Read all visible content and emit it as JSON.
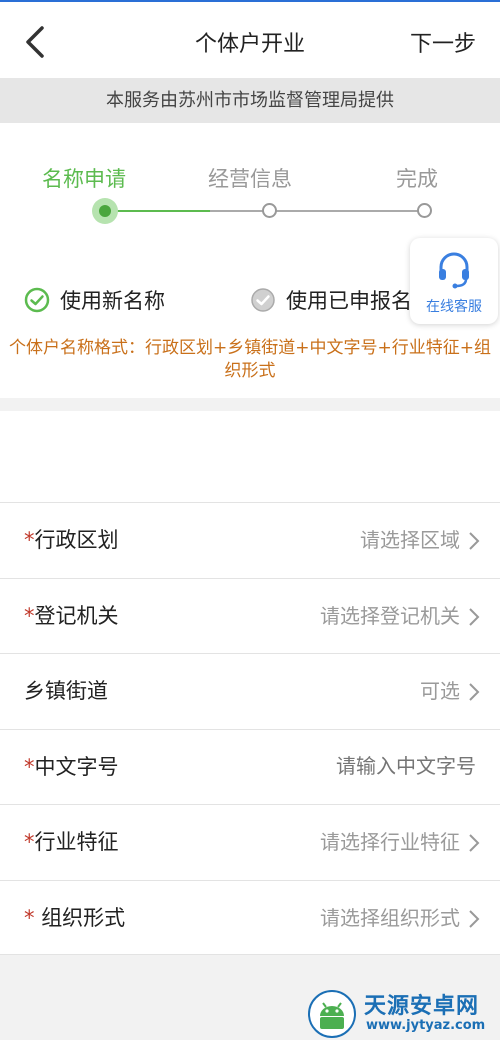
{
  "header": {
    "title": "个体户开业",
    "next_label": "下一步"
  },
  "provider_text": "本服务由苏州市市场监督管理局提供",
  "steps": [
    {
      "label": "名称申请",
      "active": true
    },
    {
      "label": "经营信息",
      "active": false
    },
    {
      "label": "完成",
      "active": false
    }
  ],
  "name_options": [
    {
      "label": "使用新名称",
      "selected": true
    },
    {
      "label": "使用已申报名称",
      "selected": false
    }
  ],
  "format_hint": "个体户名称格式：行政区划+乡镇街道+中文字号+行业特征+组织形式",
  "service": {
    "label": "在线客服"
  },
  "form_rows": [
    {
      "required": "*",
      "label": "行政区划",
      "value": "请选择区域"
    },
    {
      "required": "*",
      "label": "登记机关",
      "value": "请选择登记机关"
    },
    {
      "required": "",
      "label": "乡镇街道",
      "value": "可选"
    },
    {
      "required": "*",
      "label": "中文字号",
      "value": "请输入中文字号"
    },
    {
      "required": "*",
      "label": "行业特征",
      "value": "请选择行业特征"
    },
    {
      "required": "* ",
      "label": "组织形式",
      "value": "请选择组织形式"
    }
  ],
  "watermark": {
    "title": "天源安卓网",
    "url": "www.jytyaz.com"
  },
  "colors": {
    "active_green": "#5cbb4f",
    "hint_orange": "#c9701a",
    "link_blue": "#3a7fe0",
    "required_red": "#c0392b"
  }
}
